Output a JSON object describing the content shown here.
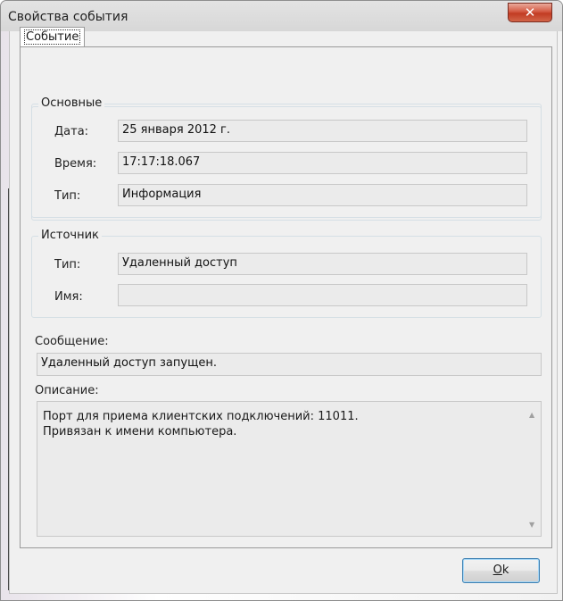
{
  "window": {
    "title": "Свойства события",
    "close_glyph": "✕"
  },
  "tabs": [
    {
      "label": "Событие",
      "active": true
    }
  ],
  "main_group": {
    "title": "Основные",
    "rows": [
      {
        "label": "Дата:",
        "value": "25 января 2012 г."
      },
      {
        "label": "Время:",
        "value": "17:17:18.067"
      },
      {
        "label": "Тип:",
        "value": "Информация"
      }
    ]
  },
  "source_group": {
    "title": "Источник",
    "rows": [
      {
        "label": "Тип:",
        "value": "Удаленный доступ"
      },
      {
        "label": "Имя:",
        "value": ""
      }
    ]
  },
  "message": {
    "label": "Сообщение:",
    "value": "Удаленный доступ запущен."
  },
  "description": {
    "label": "Описание:",
    "lines": [
      "Порт для приема клиентских подключений: 11011.",
      "Привязан к имени компьютера."
    ]
  },
  "buttons": {
    "ok_label": "Ok",
    "ok_accel": "O",
    "ok_rest": "k"
  },
  "icons": {
    "close": "close-icon",
    "scroll_up": "scroll-up-arrow-icon",
    "scroll_down": "scroll-down-arrow-icon"
  }
}
